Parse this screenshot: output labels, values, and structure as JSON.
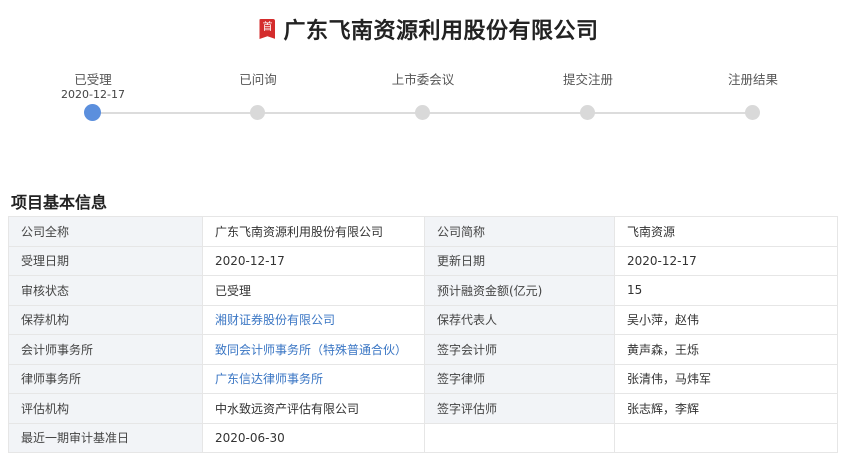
{
  "header": {
    "badge": "首",
    "title": "广东飞南资源利用股份有限公司"
  },
  "steps": [
    {
      "label": "已受理",
      "date": "2020-12-17",
      "active": true
    },
    {
      "label": "已问询",
      "date": "",
      "active": false
    },
    {
      "label": "上市委会议",
      "date": "",
      "active": false
    },
    {
      "label": "提交注册",
      "date": "",
      "active": false
    },
    {
      "label": "注册结果",
      "date": "",
      "active": false
    }
  ],
  "colors": {
    "active_step": "#5b8fdd",
    "inactive_step": "#d9d9d9",
    "link": "#3a76c4",
    "badge": "#d42c2c"
  },
  "section": {
    "title": "项目基本信息"
  },
  "info": [
    {
      "k1": "公司全称",
      "v1": "广东飞南资源利用股份有限公司",
      "k2": "公司简称",
      "v2": "飞南资源"
    },
    {
      "k1": "受理日期",
      "v1": "2020-12-17",
      "k2": "更新日期",
      "v2": "2020-12-17"
    },
    {
      "k1": "审核状态",
      "v1": "已受理",
      "k2": "预计融资金额(亿元)",
      "v2": "15"
    },
    {
      "k1": "保荐机构",
      "v1": "湘财证券股份有限公司",
      "k2": "保荐代表人",
      "v2": "吴小萍，赵伟"
    },
    {
      "k1": "会计师事务所",
      "v1": "致同会计师事务所（特殊普通合伙）",
      "k2": "签字会计师",
      "v2": "黄声森，王烁"
    },
    {
      "k1": "律师事务所",
      "v1": "广东信达律师事务所",
      "k2": "签字律师",
      "v2": "张清伟，马炜军"
    },
    {
      "k1": "评估机构",
      "v1": "中水致远资产评估有限公司",
      "k2": "签字评估师",
      "v2": "张志辉，李辉"
    },
    {
      "k1": "最近一期审计基准日",
      "v1": "2020-06-30",
      "k2": "",
      "v2": ""
    }
  ]
}
